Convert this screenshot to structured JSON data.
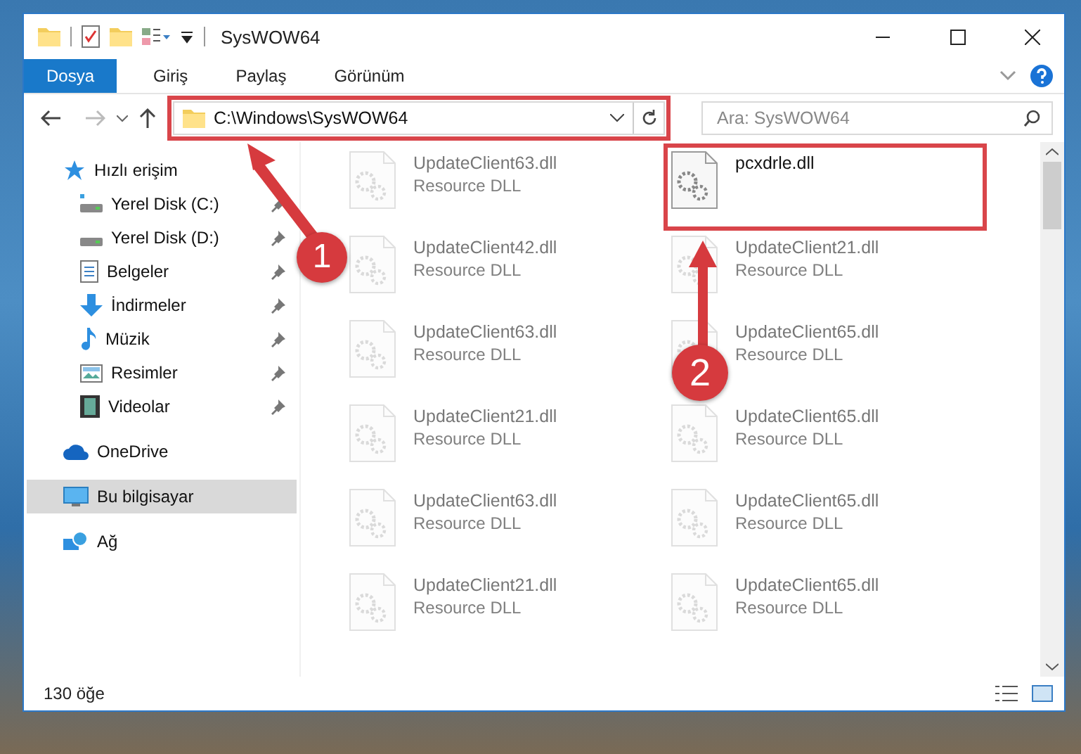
{
  "window": {
    "title": "SysWOW64"
  },
  "ribbon": {
    "tabs": [
      {
        "label": "Dosya",
        "selected": true
      },
      {
        "label": "Giriş",
        "selected": false
      },
      {
        "label": "Paylaş",
        "selected": false
      },
      {
        "label": "Görünüm",
        "selected": false
      }
    ]
  },
  "address_bar": {
    "path": "C:\\Windows\\SysWOW64",
    "highlighted": true
  },
  "search": {
    "placeholder": "Ara: SysWOW64"
  },
  "sidebar": {
    "items": [
      {
        "label": "Hızlı erişim",
        "selected": false,
        "children": [
          {
            "label": "Yerel Disk (C:)",
            "pinned": true,
            "selected": false
          },
          {
            "label": "Yerel Disk (D:)",
            "pinned": true,
            "selected": false
          },
          {
            "label": "Belgeler",
            "pinned": true,
            "selected": false
          },
          {
            "label": "İndirmeler",
            "pinned": true,
            "selected": false
          },
          {
            "label": "Müzik",
            "pinned": true,
            "selected": false
          },
          {
            "label": "Resimler",
            "pinned": true,
            "selected": false
          },
          {
            "label": "Videolar",
            "pinned": true,
            "selected": false
          }
        ]
      },
      {
        "label": "OneDrive",
        "selected": false
      },
      {
        "label": "Bu bilgisayar",
        "selected": true
      },
      {
        "label": "Ağ",
        "selected": false
      }
    ]
  },
  "files": [
    {
      "name": "UpdateClient63.dll",
      "type": "Resource DLL",
      "dimmed": true
    },
    {
      "name": "pcxdrle.dll",
      "dimmed": false,
      "highlighted": true
    },
    {
      "name": "UpdateClient42.dll",
      "type": "Resource DLL",
      "dimmed": true
    },
    {
      "name": "UpdateClient21.dll",
      "type": "Resource DLL",
      "dimmed": true
    },
    {
      "name": "UpdateClient63.dll",
      "type": "Resource DLL",
      "dimmed": true
    },
    {
      "name": "UpdateClient65.dll",
      "type": "Resource DLL",
      "dimmed": true
    },
    {
      "name": "UpdateClient21.dll",
      "type": "Resource DLL",
      "dimmed": true
    },
    {
      "name": "UpdateClient65.dll",
      "type": "Resource DLL",
      "dimmed": true
    },
    {
      "name": "UpdateClient63.dll",
      "type": "Resource DLL",
      "dimmed": true
    },
    {
      "name": "UpdateClient65.dll",
      "type": "Resource DLL",
      "dimmed": true
    },
    {
      "name": "UpdateClient21.dll",
      "type": "Resource DLL",
      "dimmed": true
    },
    {
      "name": "UpdateClient65.dll",
      "type": "Resource DLL",
      "dimmed": true
    }
  ],
  "status_bar": {
    "item_count": "130 öğe"
  },
  "annotations": [
    {
      "number": "1"
    },
    {
      "number": "2"
    }
  ]
}
